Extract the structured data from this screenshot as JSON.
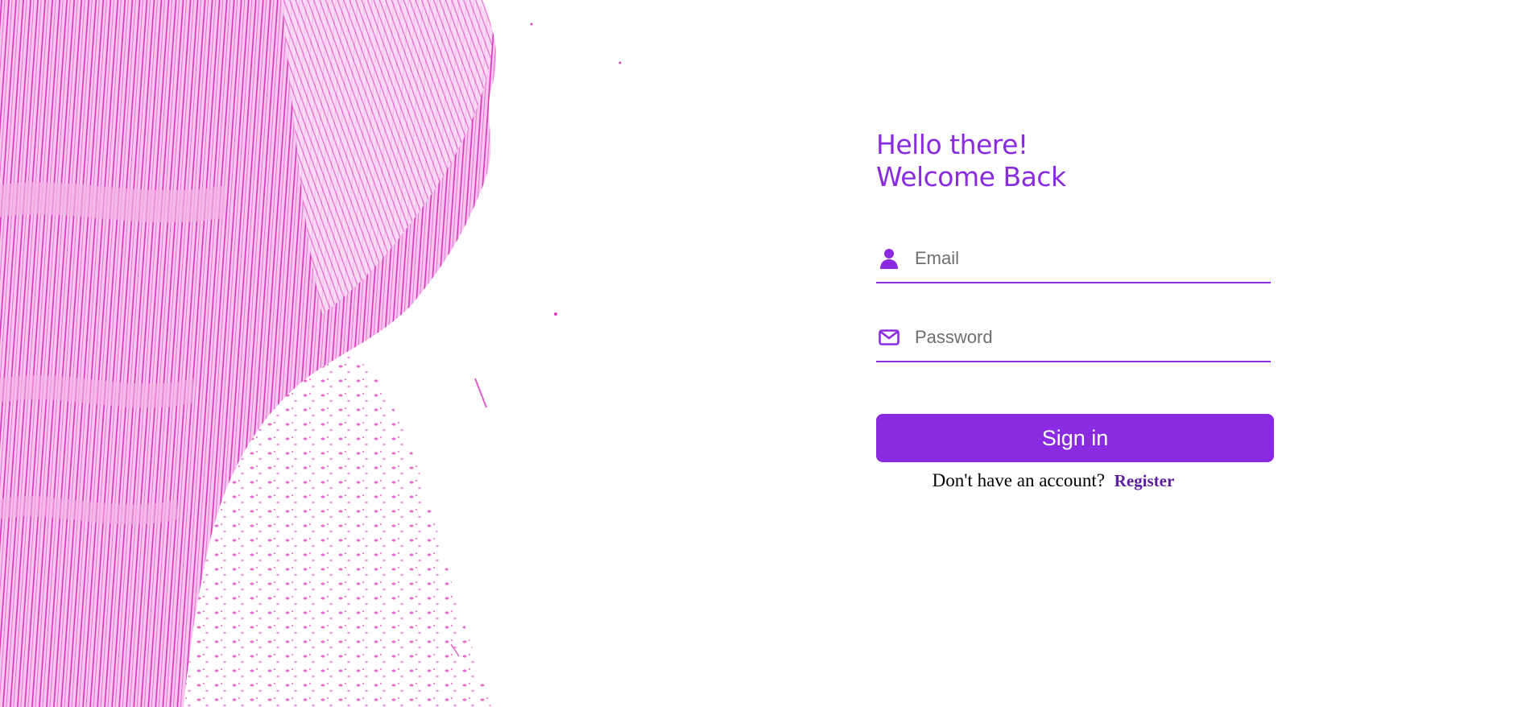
{
  "colors": {
    "accent": "#8a2be2",
    "paint": "#e040c8",
    "link": "#5b1fa0"
  },
  "greeting": {
    "line1": "Hello there!",
    "line2": "Welcome Back"
  },
  "email": {
    "icon": "user-icon",
    "placeholder": "Email",
    "value": ""
  },
  "password": {
    "icon": "envelope-icon",
    "placeholder": "Password",
    "value": ""
  },
  "signin": {
    "label": "Sign in"
  },
  "register": {
    "prompt": "Don't have an account?",
    "link_label": "Register"
  }
}
